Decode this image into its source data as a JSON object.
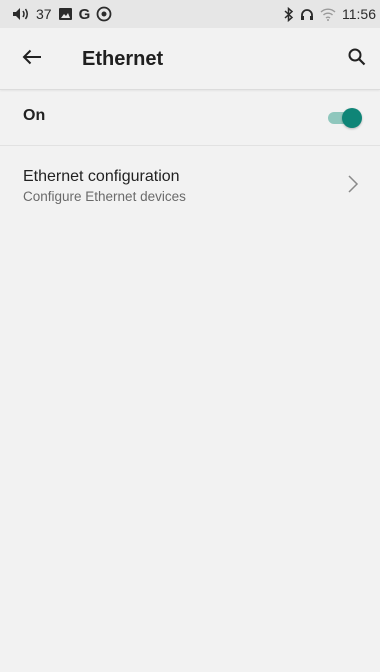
{
  "status_bar": {
    "volume_level": "37",
    "time": "11:56",
    "g_label": "G"
  },
  "app_bar": {
    "title": "Ethernet"
  },
  "settings": {
    "on_row": {
      "label": "On",
      "toggle_enabled": true,
      "accent_color": "#0f8577"
    },
    "config_row": {
      "title": "Ethernet configuration",
      "subtitle": "Configure Ethernet devices"
    }
  }
}
